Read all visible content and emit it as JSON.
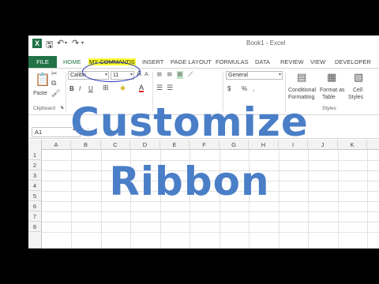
{
  "window": {
    "title": "Book1 - Excel",
    "logo": "X"
  },
  "qat": {
    "icons": [
      "save-icon",
      "undo-icon",
      "redo-icon",
      "customize-qat-icon"
    ]
  },
  "tabs": [
    "FILE",
    "HOME",
    "MY COMMANDS",
    "INSERT",
    "PAGE LAYOUT",
    "FORMULAS",
    "DATA",
    "REVIEW",
    "VIEW",
    "DEVELOPER"
  ],
  "ribbon": {
    "paste_label": "Paste",
    "font_name": "Calibri",
    "font_size": "11",
    "number_format": "General",
    "bold": "B",
    "italic": "I",
    "underline": "U",
    "font_color": "A",
    "currency": "$",
    "percent": "%",
    "comma": ",",
    "conditional_formatting": [
      "Conditional",
      "Formatting"
    ],
    "format_as_table": [
      "Format as",
      "Table"
    ],
    "cell_styles": [
      "Cell",
      "Styles"
    ],
    "groups": {
      "clipboard": "Clipboard",
      "styles": "Styles"
    }
  },
  "formula_bar": {
    "name_box": "A1"
  },
  "grid": {
    "columns": [
      "A",
      "B",
      "C",
      "D",
      "E",
      "F",
      "G",
      "H",
      "I",
      "J",
      "K"
    ],
    "rows": [
      "1",
      "2",
      "3",
      "4",
      "5",
      "6",
      "7",
      "8"
    ]
  },
  "overlay": {
    "line1": "Customize",
    "line2": "Ribbon"
  },
  "colors": {
    "excel_green": "#217346",
    "highlight_yellow": "#ffff33",
    "oval_blue": "#1f2fb8",
    "overlay_blue": "#4a7ec7"
  }
}
